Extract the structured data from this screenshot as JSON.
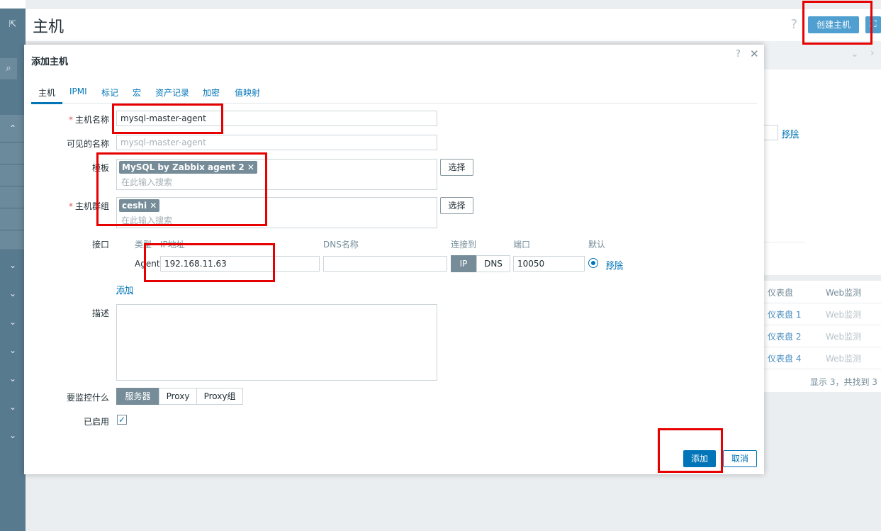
{
  "page": {
    "title": "主机",
    "help": "?",
    "create_host": "创建主机",
    "expand_icon": "⛶"
  },
  "background": {
    "remove_link": "移除",
    "table_header": {
      "dashboard": "仪表盘",
      "web": "Web监测"
    },
    "rows": [
      {
        "dashboard": "仪表盘 1",
        "web": "Web监测"
      },
      {
        "dashboard": "仪表盘 2",
        "web": "Web监测"
      },
      {
        "dashboard": "仪表盘 4",
        "web": "Web监测"
      }
    ],
    "footer": "显示 3，共找到 3"
  },
  "modal": {
    "title": "添加主机",
    "help": "?",
    "close": "✕",
    "tabs": [
      "主机",
      "IPMI",
      "标记",
      "宏",
      "资产记录",
      "加密",
      "值映射"
    ],
    "host_name": {
      "label": "主机名称",
      "value": "mysql-master-agent"
    },
    "visible_name": {
      "label": "可见的名称",
      "placeholder": "mysql-master-agent"
    },
    "templates": {
      "label": "模板",
      "chip": "MySQL by Zabbix agent 2",
      "placeholder": "在此输入搜索",
      "select": "选择"
    },
    "host_groups": {
      "label": "主机群组",
      "chip": "ceshi",
      "placeholder": "在此输入搜索",
      "select": "选择"
    },
    "interfaces": {
      "label": "接口",
      "headers": {
        "type": "类型",
        "ip": "IP地址",
        "dns": "DNS名称",
        "connect": "连接到",
        "port": "端口",
        "default": "默认"
      },
      "agent": {
        "type": "Agent",
        "ip": "192.168.11.63",
        "dns": "",
        "ip_btn": "IP",
        "dns_btn": "DNS",
        "port": "10050",
        "remove": "移除"
      },
      "add": "添加"
    },
    "description": {
      "label": "描述",
      "value": ""
    },
    "monitored_by": {
      "label": "要监控什么",
      "options": [
        "服务器",
        "Proxy",
        "Proxy组"
      ]
    },
    "enabled": {
      "label": "已启用",
      "checked": true
    },
    "buttons": {
      "add": "添加",
      "cancel": "取消"
    }
  },
  "sidebar": {
    "collapse_icon": "⇱",
    "search_icon": "⌕",
    "chevron_up": "⌃",
    "chevron_down": "⌄"
  }
}
